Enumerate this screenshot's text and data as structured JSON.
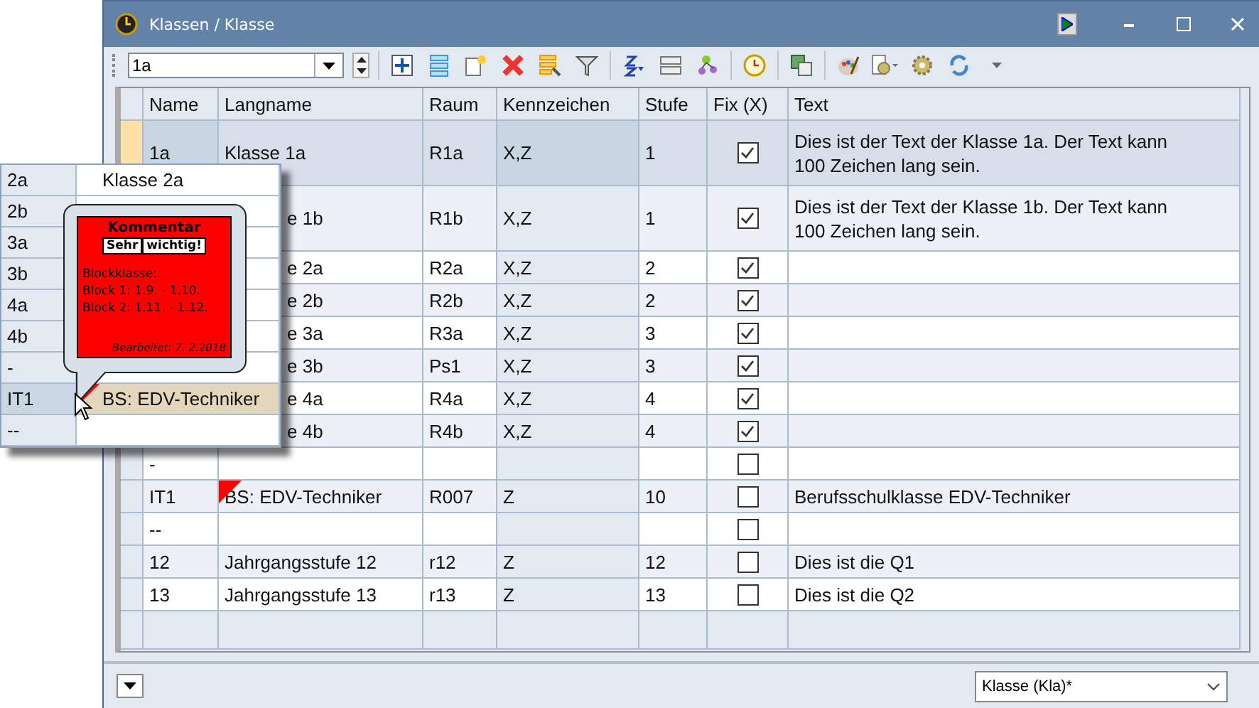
{
  "window": {
    "title": "Klassen / Klasse"
  },
  "toolbar": {
    "selector_value": "1a"
  },
  "table": {
    "columns": [
      "Name",
      "Langname",
      "Raum",
      "Kennzeichen",
      "Stufe",
      "Fix (X)",
      "Text"
    ],
    "rows": [
      {
        "name": "1a",
        "langname": "Klasse 1a",
        "raum": "R1a",
        "kennzeichen": "X,Z",
        "stufe": "1",
        "fix": true,
        "text": "Dies ist der Text der Klasse 1a. Der Text kann 100 Zeichen lang sein.",
        "selected": true,
        "comment": false
      },
      {
        "langname": "e 1b",
        "raum": "R1b",
        "kennzeichen": "X,Z",
        "stufe": "1",
        "fix": true,
        "text": "Dies ist der Text der Klasse 1b. Der Text kann 100 Zeichen lang sein.",
        "selected": false,
        "comment": false
      },
      {
        "langname": "e 2a",
        "raum": "R2a",
        "kennzeichen": "X,Z",
        "stufe": "2",
        "fix": true,
        "selected": false,
        "comment": false
      },
      {
        "langname": "e 2b",
        "raum": "R2b",
        "kennzeichen": "X,Z",
        "stufe": "2",
        "fix": true,
        "selected": false,
        "comment": false
      },
      {
        "langname": "e 3a",
        "raum": "R3a",
        "kennzeichen": "X,Z",
        "stufe": "3",
        "fix": true,
        "selected": false,
        "comment": false
      },
      {
        "langname": "e 3b",
        "raum": "Ps1",
        "kennzeichen": "X,Z",
        "stufe": "3",
        "fix": true,
        "selected": false,
        "comment": false
      },
      {
        "langname": "e 4a",
        "raum": "R4a",
        "kennzeichen": "X,Z",
        "stufe": "4",
        "fix": true,
        "selected": false,
        "comment": false
      },
      {
        "langname": "e 4b",
        "raum": "R4b",
        "kennzeichen": "X,Z",
        "stufe": "4",
        "fix": true,
        "selected": false,
        "comment": false
      },
      {
        "name": "-",
        "fix": false,
        "selected": false,
        "comment": false
      },
      {
        "name": "IT1",
        "langname": "BS: EDV-Techniker",
        "raum": "R007",
        "kennzeichen": "Z",
        "stufe": "10",
        "fix": false,
        "text": "Berufsschulklasse EDV-Techniker",
        "selected": false,
        "comment": true
      },
      {
        "name": "--",
        "fix": false,
        "selected": false,
        "comment": false
      },
      {
        "name": "12",
        "langname": "Jahrgangsstufe 12",
        "raum": "r12",
        "kennzeichen": "Z",
        "stufe": "12",
        "fix": false,
        "text": "Dies ist die Q1",
        "selected": false,
        "comment": false
      },
      {
        "name": "13",
        "langname": "Jahrgangsstufe 13",
        "raum": "r13",
        "kennzeichen": "Z",
        "stufe": "13",
        "fix": false,
        "text": "Dies ist die Q2",
        "selected": false,
        "comment": false
      }
    ]
  },
  "dropdown_list": {
    "rows": [
      {
        "name": "2a",
        "langname": "Klasse 2a",
        "selected": false,
        "comment": false
      },
      {
        "name": "2b",
        "selected": false,
        "comment": false
      },
      {
        "name": "3a",
        "selected": false,
        "comment": false
      },
      {
        "name": "3b",
        "selected": false,
        "comment": false
      },
      {
        "name": "4a",
        "selected": false,
        "comment": false
      },
      {
        "name": "4b",
        "selected": false,
        "comment": false
      },
      {
        "name": "-",
        "selected": false,
        "comment": false
      },
      {
        "name": "IT1",
        "langname": "BS: EDV-Techniker",
        "selected": true,
        "comment": true
      },
      {
        "name": "--",
        "selected": false,
        "comment": false
      }
    ]
  },
  "comment_bubble": {
    "title": "Kommentar",
    "tags": [
      "Sehr",
      "wichtig!"
    ],
    "lines": [
      "Blockklasse:",
      "Block 1: 1.9. - 1.10.",
      "Block 2: 1.11. - 1.12."
    ],
    "edited": "Bearbeitet: 7. 2.2018"
  },
  "footer": {
    "view_select": "Klasse (Kla)*"
  }
}
